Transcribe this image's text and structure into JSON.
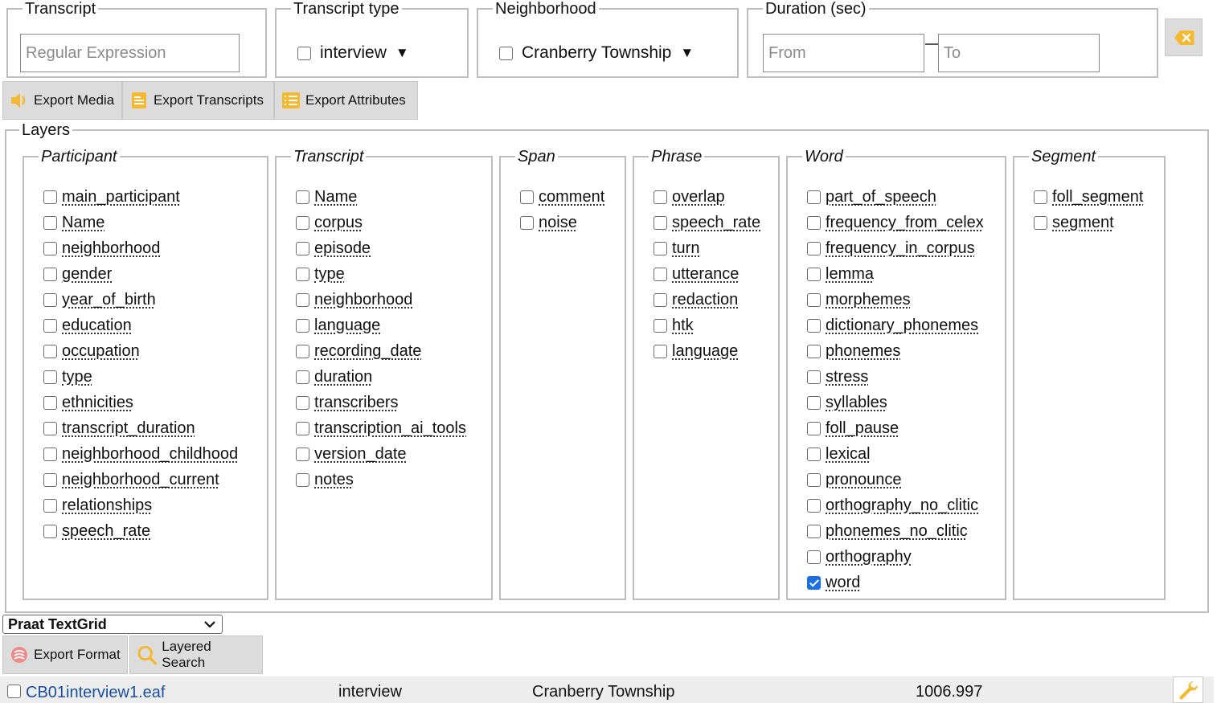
{
  "filters": {
    "transcript": {
      "legend": "Transcript",
      "placeholder": "Regular Expression"
    },
    "transcript_type": {
      "legend": "Transcript type",
      "value": "interview",
      "arrow": "▼"
    },
    "neighborhood": {
      "legend": "Neighborhood",
      "value": "Cranberry Township",
      "arrow": "▼"
    },
    "duration": {
      "legend": "Duration (sec)",
      "from_placeholder": "From",
      "to_placeholder": "To"
    },
    "clear_icon": "backspace-icon"
  },
  "export_buttons": {
    "media": {
      "label": "Export Media",
      "icon": "speaker-icon"
    },
    "transcripts": {
      "label": "Export Transcripts",
      "icon": "document-icon"
    },
    "attributes": {
      "label": "Export Attributes",
      "icon": "list-icon"
    }
  },
  "layers": {
    "legend": "Layers",
    "groups": [
      {
        "name": "Participant",
        "items": [
          "main_participant",
          "Name",
          "neighborhood",
          "gender",
          "year_of_birth",
          "education",
          "occupation",
          "type",
          "ethnicities",
          "transcript_duration",
          "neighborhood_childhood",
          "neighborhood_current",
          "relationships",
          "speech_rate"
        ],
        "checked": []
      },
      {
        "name": "Transcript",
        "items": [
          "Name",
          "corpus",
          "episode",
          "type",
          "neighborhood",
          "language",
          "recording_date",
          "duration",
          "transcribers",
          "transcription_ai_tools",
          "version_date",
          "notes"
        ],
        "checked": []
      },
      {
        "name": "Span",
        "items": [
          "comment",
          "noise"
        ],
        "checked": []
      },
      {
        "name": "Phrase",
        "items": [
          "overlap",
          "speech_rate",
          "turn",
          "utterance",
          "redaction",
          "htk",
          "language"
        ],
        "checked": []
      },
      {
        "name": "Word",
        "items": [
          "part_of_speech",
          "frequency_from_celex",
          "frequency_in_corpus",
          "lemma",
          "morphemes",
          "dictionary_phonemes",
          "phonemes",
          "stress",
          "syllables",
          "foll_pause",
          "lexical",
          "pronounce",
          "orthography_no_clitic",
          "phonemes_no_clitic",
          "orthography",
          "word"
        ],
        "checked": [
          "word"
        ]
      },
      {
        "name": "Segment",
        "items": [
          "foll_segment",
          "segment"
        ],
        "checked": []
      }
    ]
  },
  "format": {
    "selected": "Praat TextGrid"
  },
  "bottom_buttons": {
    "export_format": {
      "label": "Export Format",
      "icon": "format-icon"
    },
    "layered_search": {
      "label": "Layered Search",
      "icon": "magnifier-icon"
    }
  },
  "result": {
    "transcript": "CB01interview1.eaf",
    "type": "interview",
    "neighborhood": "Cranberry Township",
    "duration": "1006.997",
    "action_icon": "wrench-icon"
  },
  "colors": {
    "accent": "#f5b82e",
    "link": "#1a4fa3",
    "checkbox": "#1a6fe3",
    "button_bg": "#dcdcdc"
  }
}
